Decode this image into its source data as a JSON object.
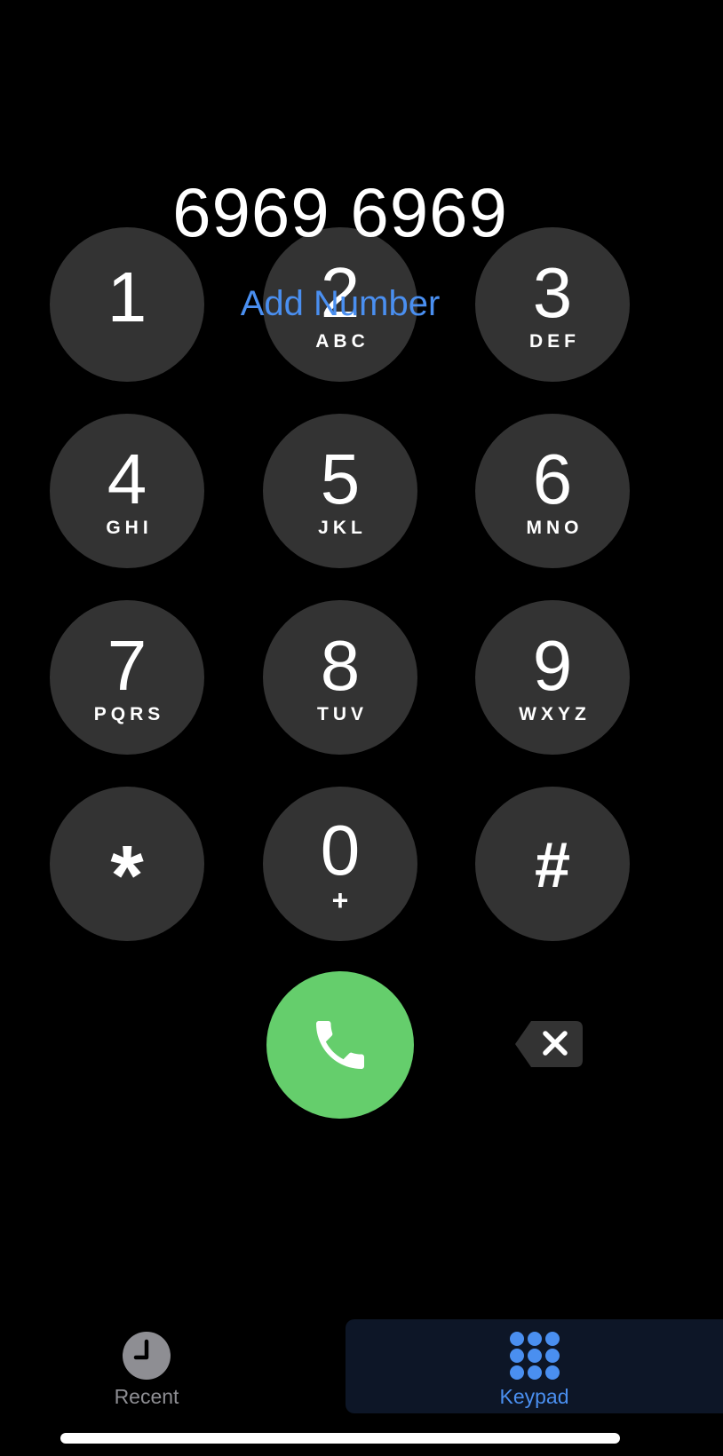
{
  "display": {
    "number": "6969 6969",
    "add_number": "Add Number"
  },
  "keypad": {
    "keys": [
      {
        "digit": "1",
        "letters": ""
      },
      {
        "digit": "2",
        "letters": "ABC"
      },
      {
        "digit": "3",
        "letters": "DEF"
      },
      {
        "digit": "4",
        "letters": "GHI"
      },
      {
        "digit": "5",
        "letters": "JKL"
      },
      {
        "digit": "6",
        "letters": "MNO"
      },
      {
        "digit": "7",
        "letters": "PQRS"
      },
      {
        "digit": "8",
        "letters": "TUV"
      },
      {
        "digit": "9",
        "letters": "WXYZ"
      },
      {
        "digit": "*",
        "letters": ""
      },
      {
        "digit": "0",
        "letters": "+"
      },
      {
        "digit": "#",
        "letters": ""
      }
    ]
  },
  "actions": {
    "call_icon": "phone-icon",
    "delete_icon": "backspace-icon"
  },
  "tabs": {
    "recent": {
      "label": "Recent",
      "icon": "clock-icon",
      "selected": false
    },
    "keypad": {
      "label": "Keypad",
      "icon": "keypad-grid-icon",
      "selected": true
    }
  },
  "colors": {
    "background": "#000000",
    "key": "#333333",
    "accent": "#4a8ff0",
    "call": "#65ce6c",
    "selected_tab_bg": "#0d1627",
    "inactive_tab": "#8e8e93"
  }
}
